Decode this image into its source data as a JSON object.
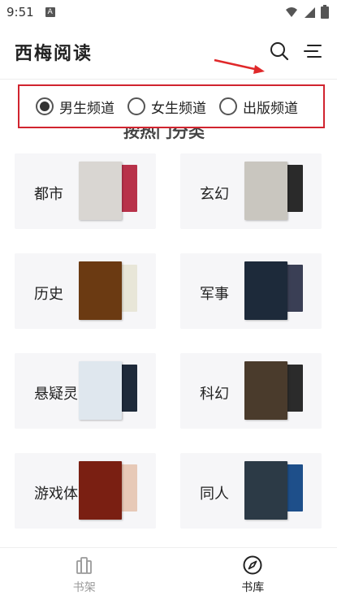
{
  "status_bar": {
    "time": "9:51",
    "a_icon": "A"
  },
  "header": {
    "title": "西梅阅读"
  },
  "channels": [
    {
      "label": "男生频道",
      "checked": true
    },
    {
      "label": "女生频道",
      "checked": false
    },
    {
      "label": "出版频道",
      "checked": false
    }
  ],
  "section": {
    "title": "按热门分类"
  },
  "categories": [
    {
      "name": "都市",
      "front_color": "#d9d6d2",
      "back_color": "#b8324a"
    },
    {
      "name": "玄幻",
      "front_color": "#c9c6bf",
      "back_color": "#2a2a2a"
    },
    {
      "name": "历史",
      "front_color": "#6b3a12",
      "back_color": "#e8e6d8"
    },
    {
      "name": "军事",
      "front_color": "#1d2a3a",
      "back_color": "#3a3f55"
    },
    {
      "name": "悬疑灵",
      "front_color": "#dfe7ee",
      "back_color": "#1e2a3a"
    },
    {
      "name": "科幻",
      "front_color": "#4a3b2c",
      "back_color": "#2b2b2b"
    },
    {
      "name": "游戏体",
      "front_color": "#7a1f12",
      "back_color": "#e7c9b7"
    },
    {
      "name": "同人",
      "front_color": "#2c3a46",
      "back_color": "#1e4f8a"
    }
  ],
  "nav": [
    {
      "label": "书架",
      "active": false
    },
    {
      "label": "书库",
      "active": true
    }
  ]
}
